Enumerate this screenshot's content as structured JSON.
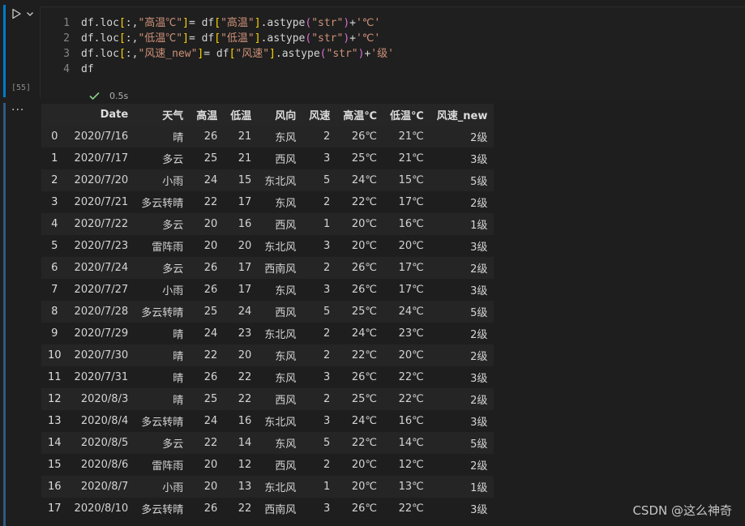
{
  "cell": {
    "execution_count": "[55]",
    "status_time": "0.5s",
    "lines": [
      {
        "num": "1",
        "tokens": [
          {
            "t": "df.loc",
            "c": "t-plain"
          },
          {
            "t": "[",
            "c": "t-brk2"
          },
          {
            "t": ":,",
            "c": "t-plain"
          },
          {
            "t": "\"高温℃\"",
            "c": "t-str"
          },
          {
            "t": "]",
            "c": "t-brk2"
          },
          {
            "t": "= df",
            "c": "t-plain"
          },
          {
            "t": "[",
            "c": "t-brk2"
          },
          {
            "t": "\"高温\"",
            "c": "t-str"
          },
          {
            "t": "]",
            "c": "t-brk2"
          },
          {
            "t": ".astype",
            "c": "t-plain"
          },
          {
            "t": "(",
            "c": "t-brk"
          },
          {
            "t": "\"str\"",
            "c": "t-str"
          },
          {
            "t": ")",
            "c": "t-brk"
          },
          {
            "t": "+",
            "c": "t-plain"
          },
          {
            "t": "'℃'",
            "c": "t-str"
          }
        ]
      },
      {
        "num": "2",
        "tokens": [
          {
            "t": "df.loc",
            "c": "t-plain"
          },
          {
            "t": "[",
            "c": "t-brk2"
          },
          {
            "t": ":,",
            "c": "t-plain"
          },
          {
            "t": "\"低温℃\"",
            "c": "t-str"
          },
          {
            "t": "]",
            "c": "t-brk2"
          },
          {
            "t": "= df",
            "c": "t-plain"
          },
          {
            "t": "[",
            "c": "t-brk2"
          },
          {
            "t": "\"低温\"",
            "c": "t-str"
          },
          {
            "t": "]",
            "c": "t-brk2"
          },
          {
            "t": ".astype",
            "c": "t-plain"
          },
          {
            "t": "(",
            "c": "t-brk"
          },
          {
            "t": "\"str\"",
            "c": "t-str"
          },
          {
            "t": ")",
            "c": "t-brk"
          },
          {
            "t": "+",
            "c": "t-plain"
          },
          {
            "t": "'℃'",
            "c": "t-str"
          }
        ]
      },
      {
        "num": "3",
        "tokens": [
          {
            "t": "df.loc",
            "c": "t-plain"
          },
          {
            "t": "[",
            "c": "t-brk2"
          },
          {
            "t": ":,",
            "c": "t-plain"
          },
          {
            "t": "\"风速_new\"",
            "c": "t-str"
          },
          {
            "t": "]",
            "c": "t-brk2"
          },
          {
            "t": "= df",
            "c": "t-plain"
          },
          {
            "t": "[",
            "c": "t-brk2"
          },
          {
            "t": "\"风速\"",
            "c": "t-str"
          },
          {
            "t": "]",
            "c": "t-brk2"
          },
          {
            "t": ".astype",
            "c": "t-plain"
          },
          {
            "t": "(",
            "c": "t-brk"
          },
          {
            "t": "\"str\"",
            "c": "t-str"
          },
          {
            "t": ")",
            "c": "t-brk"
          },
          {
            "t": "+",
            "c": "t-plain"
          },
          {
            "t": "'级'",
            "c": "t-str"
          }
        ]
      },
      {
        "num": "4",
        "tokens": [
          {
            "t": "df",
            "c": "t-plain"
          }
        ]
      }
    ]
  },
  "output": {
    "menu_label": "···",
    "columns": [
      "",
      "Date",
      "天气",
      "高温",
      "低温",
      "风向",
      "风速",
      "高温℃",
      "低温℃",
      "风速_new"
    ],
    "rows": [
      [
        "0",
        "2020/7/16",
        "晴",
        "26",
        "21",
        "东风",
        "2",
        "26℃",
        "21℃",
        "2级"
      ],
      [
        "1",
        "2020/7/17",
        "多云",
        "25",
        "21",
        "西风",
        "3",
        "25℃",
        "21℃",
        "3级"
      ],
      [
        "2",
        "2020/7/20",
        "小雨",
        "24",
        "15",
        "东北风",
        "5",
        "24℃",
        "15℃",
        "5级"
      ],
      [
        "3",
        "2020/7/21",
        "多云转晴",
        "22",
        "17",
        "东风",
        "2",
        "22℃",
        "17℃",
        "2级"
      ],
      [
        "4",
        "2020/7/22",
        "多云",
        "20",
        "16",
        "西风",
        "1",
        "20℃",
        "16℃",
        "1级"
      ],
      [
        "5",
        "2020/7/23",
        "雷阵雨",
        "20",
        "20",
        "东北风",
        "3",
        "20℃",
        "20℃",
        "3级"
      ],
      [
        "6",
        "2020/7/24",
        "多云",
        "26",
        "17",
        "西南风",
        "2",
        "26℃",
        "17℃",
        "2级"
      ],
      [
        "7",
        "2020/7/27",
        "小雨",
        "26",
        "17",
        "东风",
        "3",
        "26℃",
        "17℃",
        "3级"
      ],
      [
        "8",
        "2020/7/28",
        "多云转晴",
        "25",
        "24",
        "西风",
        "5",
        "25℃",
        "24℃",
        "5级"
      ],
      [
        "9",
        "2020/7/29",
        "晴",
        "24",
        "23",
        "东北风",
        "2",
        "24℃",
        "23℃",
        "2级"
      ],
      [
        "10",
        "2020/7/30",
        "晴",
        "22",
        "20",
        "东风",
        "2",
        "22℃",
        "20℃",
        "2级"
      ],
      [
        "11",
        "2020/7/31",
        "晴",
        "26",
        "22",
        "东风",
        "3",
        "26℃",
        "22℃",
        "3级"
      ],
      [
        "12",
        "2020/8/3",
        "晴",
        "25",
        "22",
        "西风",
        "2",
        "25℃",
        "22℃",
        "2级"
      ],
      [
        "13",
        "2020/8/4",
        "多云转晴",
        "24",
        "16",
        "东北风",
        "3",
        "24℃",
        "16℃",
        "3级"
      ],
      [
        "14",
        "2020/8/5",
        "多云",
        "22",
        "14",
        "东风",
        "5",
        "22℃",
        "14℃",
        "5级"
      ],
      [
        "15",
        "2020/8/6",
        "雷阵雨",
        "20",
        "12",
        "西风",
        "2",
        "20℃",
        "12℃",
        "2级"
      ],
      [
        "16",
        "2020/8/7",
        "小雨",
        "20",
        "13",
        "东北风",
        "1",
        "20℃",
        "13℃",
        "1级"
      ],
      [
        "17",
        "2020/8/10",
        "多云转晴",
        "26",
        "22",
        "西南风",
        "3",
        "26℃",
        "22℃",
        "3级"
      ]
    ]
  },
  "watermark": "CSDN @这么神奇",
  "icons": {
    "run": "run-cell-icon",
    "chevron": "chevron-down-icon",
    "check": "check-icon",
    "more": "more-actions-icon"
  },
  "colors": {
    "accent": "#007acc",
    "success": "#89d185",
    "string": "#ce9178",
    "bracket_round": "#da70d6",
    "bracket_square": "#ffd700"
  }
}
